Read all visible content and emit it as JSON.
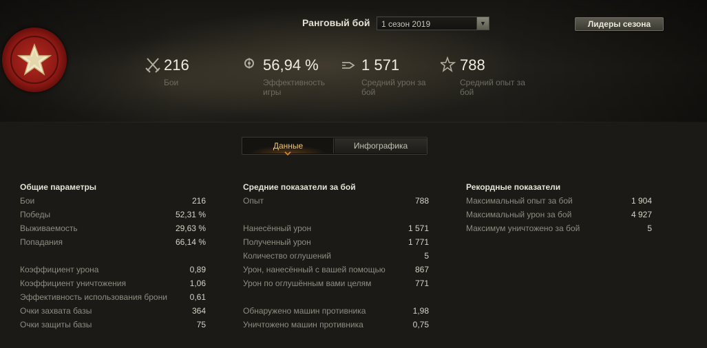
{
  "header": {
    "title": "Ранговый бой",
    "season_selected": "1 сезон 2019",
    "leaders_button": "Лидеры сезона"
  },
  "summary": [
    {
      "icon": "crossed-swords-icon",
      "value": "216",
      "label": "Бои"
    },
    {
      "icon": "efficiency-target-icon",
      "value": "56,94 %",
      "label": "Эффективность игры"
    },
    {
      "icon": "shell-damage-icon",
      "value": "1 571",
      "label": "Средний урон за бой"
    },
    {
      "icon": "star-experience-icon",
      "value": "788",
      "label": "Средний опыт за бой"
    }
  ],
  "tabs": {
    "data": "Данные",
    "infographics": "Инфографика",
    "active": "data"
  },
  "general": {
    "title": "Общие параметры",
    "groups": [
      [
        {
          "k": "Бои",
          "v": "216"
        },
        {
          "k": "Победы",
          "v": "52,31 %"
        },
        {
          "k": "Выживаемость",
          "v": "29,63 %"
        },
        {
          "k": "Попадания",
          "v": "66,14 %"
        }
      ],
      [
        {
          "k": "Коэффициент урона",
          "v": "0,89"
        },
        {
          "k": "Коэффициент уничтожения",
          "v": "1,06"
        },
        {
          "k": "Эффективность использования брони",
          "v": "0,61"
        },
        {
          "k": "Очки захвата базы",
          "v": "364"
        },
        {
          "k": "Очки защиты базы",
          "v": "75"
        }
      ]
    ]
  },
  "average": {
    "title": "Средние показатели за бой",
    "groups": [
      [
        {
          "k": "Опыт",
          "v": "788"
        }
      ],
      [
        {
          "k": "Нанесённый урон",
          "v": "1 571"
        },
        {
          "k": "Полученный урон",
          "v": "1 771"
        },
        {
          "k": "Количество оглушений",
          "v": "5"
        },
        {
          "k": "Урон, нанесённый с вашей помощью",
          "v": "867"
        },
        {
          "k": "Урон по оглушённым вами целям",
          "v": "771"
        }
      ],
      [
        {
          "k": "Обнаружено машин противника",
          "v": "1,98"
        },
        {
          "k": "Уничтожено машин противника",
          "v": "0,75"
        }
      ]
    ]
  },
  "records": {
    "title": "Рекордные показатели",
    "groups": [
      [
        {
          "k": "Максимальный опыт за бой",
          "v": "1 904"
        },
        {
          "k": "Максимальный урон за бой",
          "v": "4 927"
        },
        {
          "k": "Максимум уничтожено за бой",
          "v": "5"
        }
      ]
    ]
  },
  "colors": {
    "accent_tab": "#f0c772",
    "emblem_red": "#8c1813",
    "text_light": "#efede0",
    "text_muted": "#6d6c62"
  }
}
